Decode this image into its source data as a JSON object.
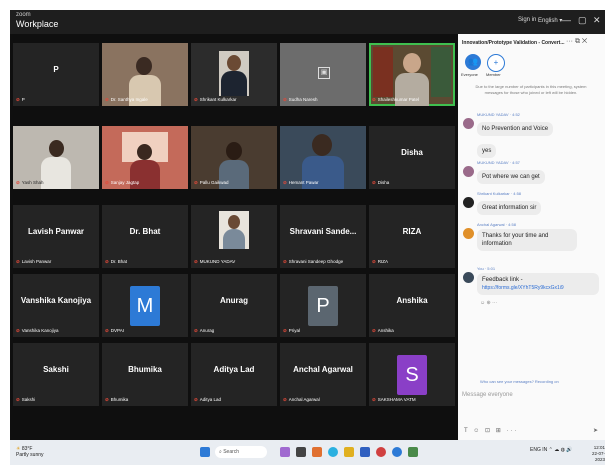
{
  "app": {
    "brand_small": "zoom",
    "name": "Workplace"
  },
  "titlebar": {
    "signin": "Sign in",
    "language": "English ▾",
    "minimize": "—",
    "restore": "▢",
    "close": "✕"
  },
  "tiles": [
    {
      "name": "P",
      "label": "P"
    },
    {
      "name": "",
      "label": "Dr. Santhya Ingale"
    },
    {
      "name": "",
      "label": "Shrikant Kulkarkar"
    },
    {
      "name": "",
      "label": "Sudha Naresh"
    },
    {
      "name": "",
      "label": "Shaileshkumar Patel"
    },
    {
      "name": "",
      "label": "Yash Shah"
    },
    {
      "name": "",
      "label": "Sanjay Jagtap"
    },
    {
      "name": "",
      "label": "Pallu Gaikwad"
    },
    {
      "name": "",
      "label": "Hemant Pawar"
    },
    {
      "name": "Disha",
      "label": "Disha"
    },
    {
      "name": "Lavish Panwar",
      "label": "Lavish Panwar"
    },
    {
      "name": "Dr. Bhat",
      "label": "Dr. Bhat"
    },
    {
      "name": "",
      "label": "MUKUND YADAV"
    },
    {
      "name": "Shravani Sande...",
      "label": "Shravani Sandeep Ghodge"
    },
    {
      "name": "RIZA",
      "label": "RIZA"
    },
    {
      "name": "Vanshika Kanojiya",
      "label": "Vanshika Kanojiya"
    },
    {
      "name": "",
      "avatar": "M",
      "label": "DVPAI"
    },
    {
      "name": "Anurag",
      "label": "Anurag"
    },
    {
      "name": "",
      "avatar": "P",
      "label": "Priyal"
    },
    {
      "name": "Anshika",
      "label": "Anshika"
    },
    {
      "name": "Sakshi",
      "label": "Sakshi"
    },
    {
      "name": "Bhumika",
      "label": "Bhumika"
    },
    {
      "name": "Aditya Lad",
      "label": "Aditya Lad"
    },
    {
      "name": "Anchal Agarwal",
      "label": "Anchal Agarwal"
    },
    {
      "name": "",
      "avatar": "S",
      "label": "SAKSHAMA VATM"
    }
  ],
  "chat": {
    "title": "Innovation/Prototype Validation - Convert...",
    "title_icons": "··· ⧉ ✕",
    "tab_everyone": "Everyone",
    "tab_everyone_icon": "👥",
    "tab_add": "+",
    "tab_add_label": "Member",
    "system_message": "Due to the large number of participants in this meeting, system messages for those who joined or left will be hidden.",
    "messages": [
      {
        "from": "MUKUND YADAV · 4:52",
        "text": "No Prevention and Voice"
      },
      {
        "from": "",
        "text": "yes"
      },
      {
        "from": "MUKUND YADAV · 4:57",
        "text": "Pot where we can get"
      },
      {
        "from": "Shrikant Kulkarkar · 4:58",
        "text": "Great information sir"
      },
      {
        "from": "Anchal Agarwal · 4:58",
        "text": "Thanks for your time and information"
      },
      {
        "from": "You · 5:01",
        "text": "Feedback link -",
        "link": "https://forms.gle/XYhT5Ry9kcxGx1i9"
      }
    ],
    "reactions": "☺ ⊕ ···",
    "who_can_see": "Who can see your messages? Recording on",
    "placeholder": "Message everyone",
    "toolbar": "T ☺ ⊡ ⊞ ···",
    "send": "➤"
  },
  "taskbar": {
    "weather_temp": "83°F",
    "weather_desc": "Partly sunny",
    "search": "Search",
    "tray": "ENG IN  ⌃ ☁ ◍ 🔊",
    "time": "12:01",
    "date": "22-07-2023"
  },
  "colors": {
    "active_speaker": "#3fbf4f",
    "avatar_m": "#2d7ad6",
    "avatar_p": "#5b6670",
    "avatar_s": "#8a3fc7",
    "mic_muted": "#e34a3a"
  }
}
